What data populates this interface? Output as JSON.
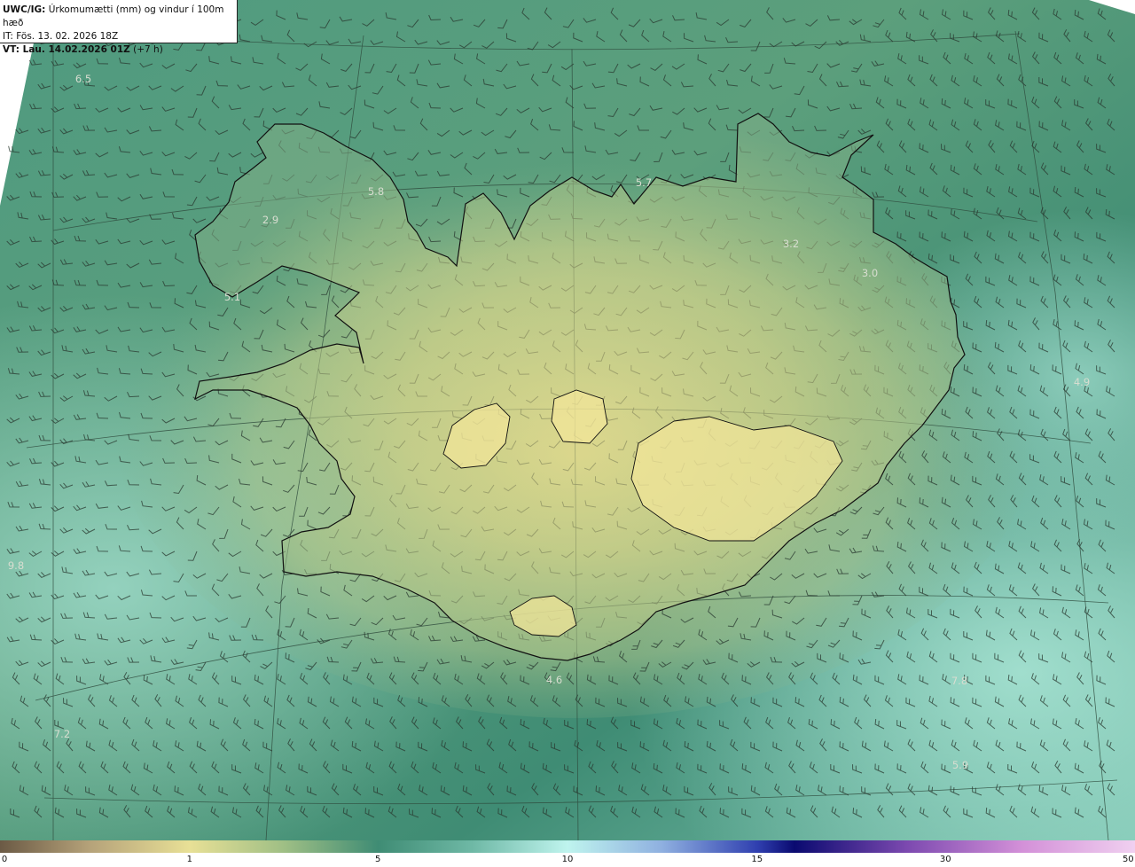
{
  "header": {
    "line1_bold": "UWC/IG:",
    "line1_text": "Úrkomumætti (mm) og vindur í 100m hæð",
    "line2": "IT: Fös. 13. 02. 2026 18Z",
    "line3_bold": "VT: Lau. 14.02.2026 01Z",
    "line3_text": "(+7 h)"
  },
  "map_labels": [
    {
      "text": "6.5",
      "tone": "light"
    },
    {
      "text": "5.8",
      "tone": "light"
    },
    {
      "text": "5.7",
      "tone": "light"
    },
    {
      "text": "2.9",
      "tone": "light"
    },
    {
      "text": "5.1",
      "tone": "light"
    },
    {
      "text": "3.2",
      "tone": "light"
    },
    {
      "text": "3.0",
      "tone": "light"
    },
    {
      "text": "4.9",
      "tone": "light"
    },
    {
      "text": "9.8",
      "tone": "light"
    },
    {
      "text": "4.6",
      "tone": "light"
    },
    {
      "text": "7.8",
      "tone": "light"
    },
    {
      "text": "7.2",
      "tone": "light"
    },
    {
      "text": "5.9",
      "tone": "light"
    }
  ],
  "colorbar": {
    "ticks": [
      "0",
      "1",
      "5",
      "10",
      "15",
      "30",
      "50"
    ]
  }
}
